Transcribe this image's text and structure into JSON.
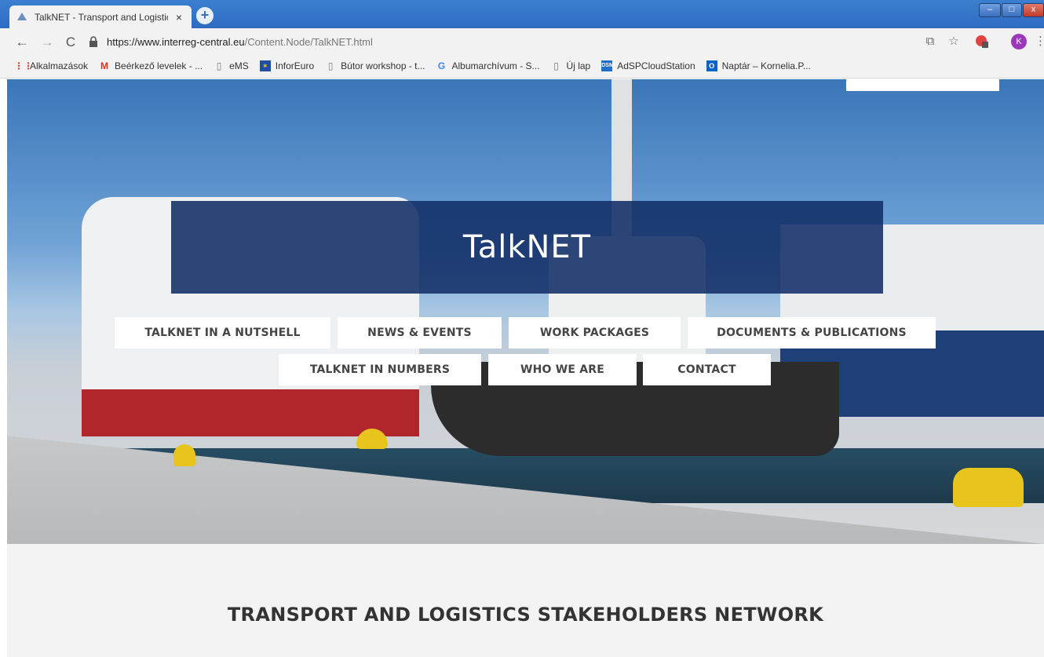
{
  "browser": {
    "tab_title": "TalkNET - Transport and Logistic",
    "tab_close": "×",
    "new_tab": "+",
    "url_host": "https://www.interreg-central.eu",
    "url_path": "/Content.Node/TalkNET.html",
    "profile_initial": "K",
    "extension_badge": "1"
  },
  "bookmarks": [
    {
      "label": "Alkalmazások",
      "icon": "apps-grid-icon"
    },
    {
      "label": "Beérkező levelek - ...",
      "icon": "gmail-icon"
    },
    {
      "label": "eMS",
      "icon": "page-icon"
    },
    {
      "label": "InforEuro",
      "icon": "eu-flag-icon"
    },
    {
      "label": "Bútor workshop - t...",
      "icon": "page-icon"
    },
    {
      "label": "Albumarchívum - S...",
      "icon": "google-icon"
    },
    {
      "label": "Új lap",
      "icon": "page-icon"
    },
    {
      "label": "AdSPCloudStation",
      "icon": "dsm-icon"
    },
    {
      "label": "Naptár – Kornelia.P...",
      "icon": "outlook-icon"
    }
  ],
  "hero": {
    "title": "TalkNET"
  },
  "nav": {
    "row1": [
      "TALKNET IN A NUTSHELL",
      "NEWS & EVENTS",
      "WORK PACKAGES",
      "DOCUMENTS & PUBLICATIONS"
    ],
    "row2": [
      "TALKNET IN NUMBERS",
      "WHO WE ARE",
      "CONTACT"
    ]
  },
  "section": {
    "title": "TRANSPORT AND LOGISTICS STAKEHOLDERS NETWORK"
  },
  "colors": {
    "title_box": "#122e66",
    "tab_strip": "#3a7fd0"
  }
}
